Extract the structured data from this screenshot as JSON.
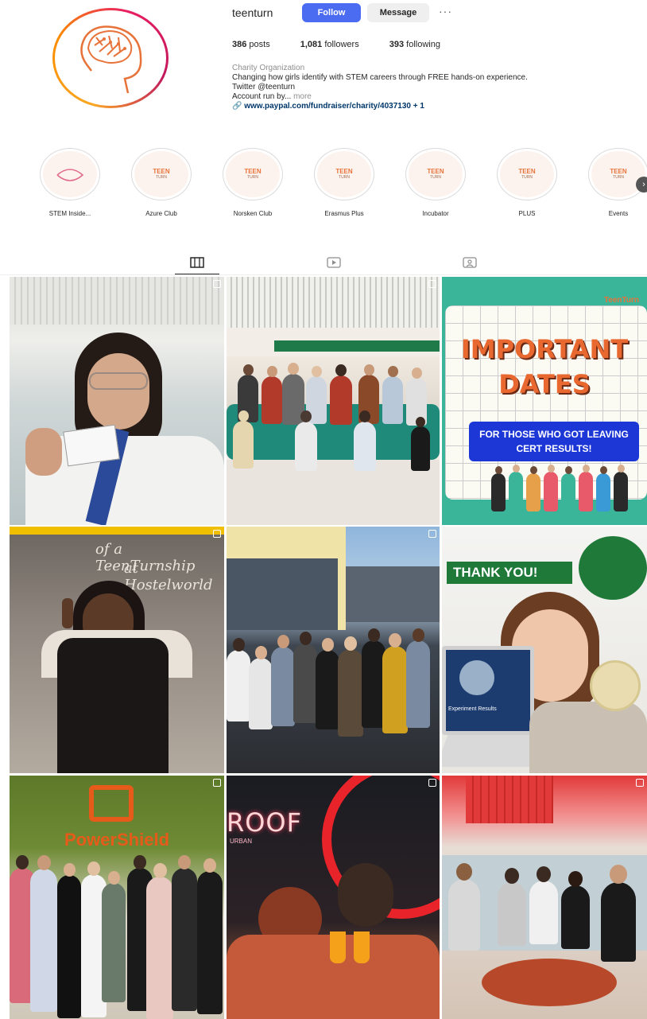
{
  "profile": {
    "username": "teenturn",
    "follow_label": "Follow",
    "message_label": "Message",
    "more_label": "···",
    "posts_count": "386",
    "posts_label": "posts",
    "followers_count": "1,081",
    "followers_label": "followers",
    "following_count": "393",
    "following_label": "following",
    "category": "Charity Organization",
    "bio_line1": "Changing how girls identify with STEM careers through FREE hands-on experience.",
    "bio_line2": "Twitter @teenturn",
    "bio_line3": "Account run by...",
    "bio_more": "more",
    "link": "www.paypal.com/fundraiser/charity/4037130",
    "link_extra": "+ 1"
  },
  "highlights": [
    {
      "label": "STEM Inside...",
      "logo": "",
      "sub": ""
    },
    {
      "label": "Azure Club",
      "logo": "TEEN",
      "sub": "TURN"
    },
    {
      "label": "Norsken Club",
      "logo": "TEEN",
      "sub": "TURN"
    },
    {
      "label": "Erasmus Plus",
      "logo": "TEEN",
      "sub": "TURN"
    },
    {
      "label": "Incubator",
      "logo": "TEEN",
      "sub": "TURN"
    },
    {
      "label": "PLUS",
      "logo": "TEEN",
      "sub": "TURN"
    },
    {
      "label": "Events",
      "logo": "TEEN",
      "sub": "TURN"
    }
  ],
  "tabs": [
    {
      "name": "posts-tab",
      "icon": "grid-icon"
    },
    {
      "name": "reels-tab",
      "icon": "video-icon"
    },
    {
      "name": "tagged-tab",
      "icon": "tag-icon"
    }
  ],
  "grid": {
    "important_title_1": "IMPORTANT",
    "important_title_2": "DATES",
    "important_box": "FOR THOSE WHO GOT LEAVING CERT RESULTS!",
    "important_corner": "TeenTurn",
    "thank_you": "THANK YOU!",
    "overlay_line1": "of a TeenTurnship",
    "overlay_line2": "at Hostelworld",
    "roof_text": "ROOF",
    "roof_sub": "URBAN",
    "ps_text": "PowerShield",
    "laptop_label": "Experiment Results"
  },
  "colors": {
    "follow": "#4b6cf0",
    "accent_orange": "#e8733a",
    "link": "#00376b"
  }
}
